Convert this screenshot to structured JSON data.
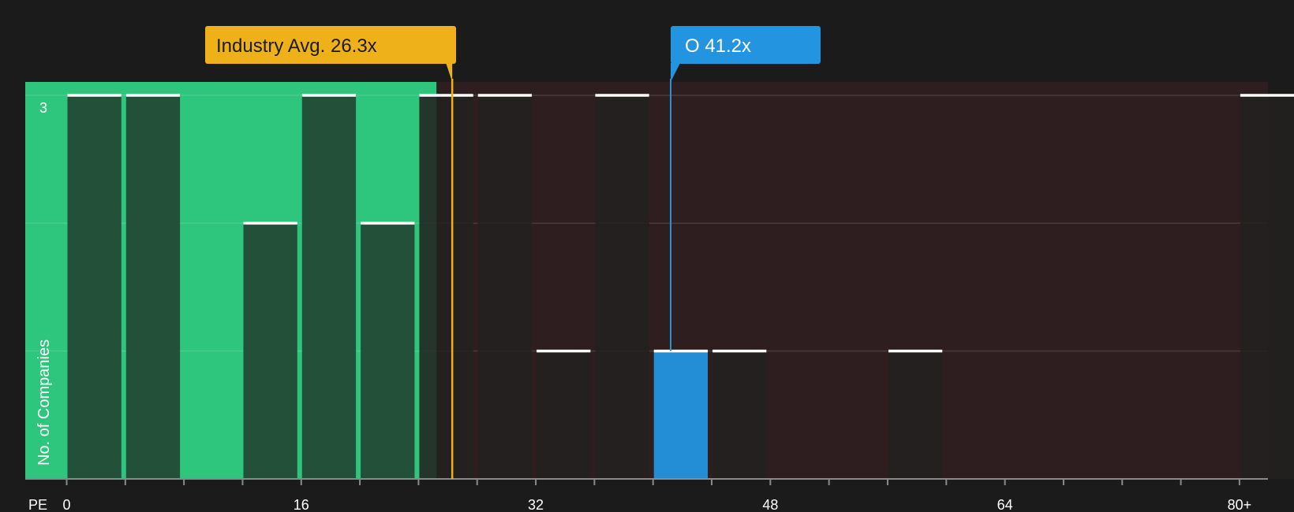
{
  "chart_data": {
    "type": "bar",
    "x_axis_label": "PE",
    "y_axis_label": "No. of Companies",
    "x_tick_labels": [
      {
        "value": 0,
        "label": "0"
      },
      {
        "value": 16,
        "label": "16"
      },
      {
        "value": 32,
        "label": "32"
      },
      {
        "value": 48,
        "label": "48"
      },
      {
        "value": 64,
        "label": "64"
      },
      {
        "value": 80,
        "label": "80+"
      }
    ],
    "x_range": [
      0,
      82
    ],
    "y_range": [
      0,
      3
    ],
    "y_tick_labels": [
      {
        "value": 3,
        "label": "3"
      }
    ],
    "bin_width": 4,
    "bins": [
      {
        "start": 0,
        "count": 3
      },
      {
        "start": 4,
        "count": 3
      },
      {
        "start": 12,
        "count": 2
      },
      {
        "start": 16,
        "count": 3
      },
      {
        "start": 20,
        "count": 2
      },
      {
        "start": 24,
        "count": 3
      },
      {
        "start": 28,
        "count": 3
      },
      {
        "start": 32,
        "count": 1
      },
      {
        "start": 36,
        "count": 3
      },
      {
        "start": 40,
        "count": 1,
        "highlight": true
      },
      {
        "start": 44,
        "count": 1
      },
      {
        "start": 56,
        "count": 1
      },
      {
        "start": 80,
        "count": 3
      }
    ],
    "industry_avg": {
      "value": 26.3,
      "label": "Industry Avg. 26.3x"
    },
    "company": {
      "value": 41.2,
      "label": "O 41.2x"
    },
    "grid": true,
    "colors": {
      "background": "#1b1b1b",
      "undervalued_zone": "#2ec67c",
      "overvalued_zone": "#2e1e1f",
      "bar_in_green": "#234a36",
      "bar_in_dark": "#232120",
      "bar_top_line": "#ffffff",
      "highlight_bar": "#2394e0",
      "industry_callout": "#eeb11a",
      "company_callout": "#2394e0"
    }
  }
}
